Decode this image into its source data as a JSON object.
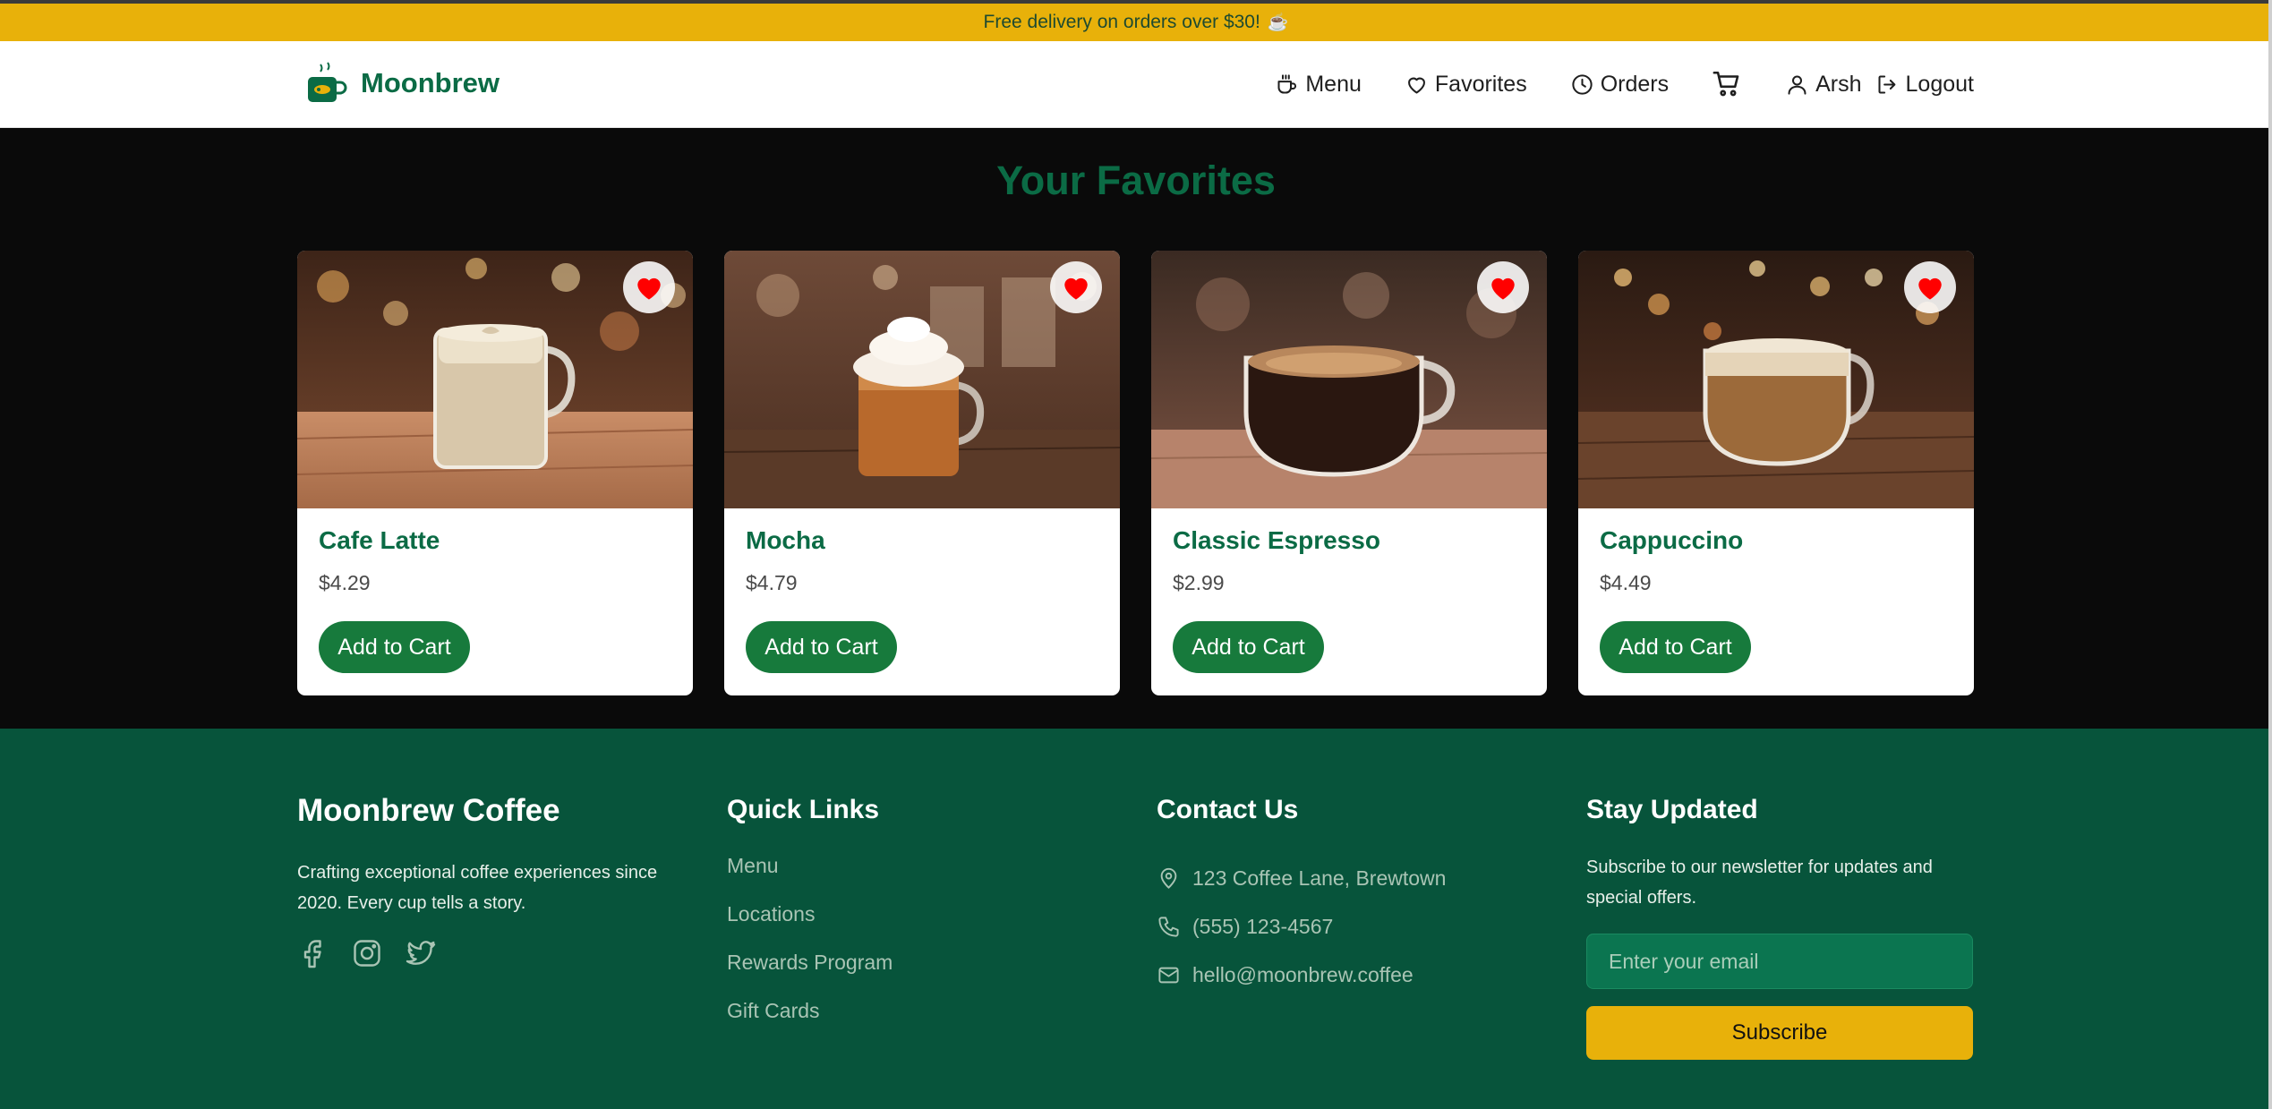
{
  "promo": {
    "text": "Free delivery on orders over $30!",
    "icon": "coffee-cup-emoji"
  },
  "brand": {
    "name": "Moonbrew",
    "logo_icon": "coffee-mug-logo-icon"
  },
  "nav": {
    "items": [
      {
        "label": "Menu",
        "icon": "coffee-cup-icon"
      },
      {
        "label": "Favorites",
        "icon": "heart-icon"
      },
      {
        "label": "Orders",
        "icon": "clock-icon"
      }
    ],
    "cart_icon": "cart-icon",
    "user": {
      "label": "Arsh",
      "icon": "user-icon"
    },
    "logout": {
      "label": "Logout",
      "icon": "logout-icon"
    }
  },
  "favorites": {
    "title": "Your Favorites",
    "add_label": "Add to Cart",
    "favorite_icon": "heart-filled-icon",
    "items": [
      {
        "name": "Cafe Latte",
        "price": "$4.29"
      },
      {
        "name": "Mocha",
        "price": "$4.79"
      },
      {
        "name": "Classic Espresso",
        "price": "$2.99"
      },
      {
        "name": "Cappuccino",
        "price": "$4.49"
      }
    ]
  },
  "footer": {
    "brand_title": "Moonbrew Coffee",
    "brand_text": "Crafting exceptional coffee experiences since 2020. Every cup tells a story.",
    "socials": [
      "facebook-icon",
      "instagram-icon",
      "twitter-icon"
    ],
    "quick_links": {
      "heading": "Quick Links",
      "items": [
        "Menu",
        "Locations",
        "Rewards Program",
        "Gift Cards"
      ]
    },
    "contact": {
      "heading": "Contact Us",
      "address": "123 Coffee Lane, Brewtown",
      "phone": "(555) 123-4567",
      "email": "hello@moonbrew.coffee"
    },
    "newsletter": {
      "heading": "Stay Updated",
      "text": "Subscribe to our newsletter for updates and special offers.",
      "placeholder": "Enter your email",
      "button": "Subscribe"
    }
  },
  "colors": {
    "brand_green": "#0b6b45",
    "button_green": "#177a3c",
    "footer_green": "#07543b",
    "accent_yellow": "#e8b10a",
    "heart_red": "#ff0000"
  }
}
